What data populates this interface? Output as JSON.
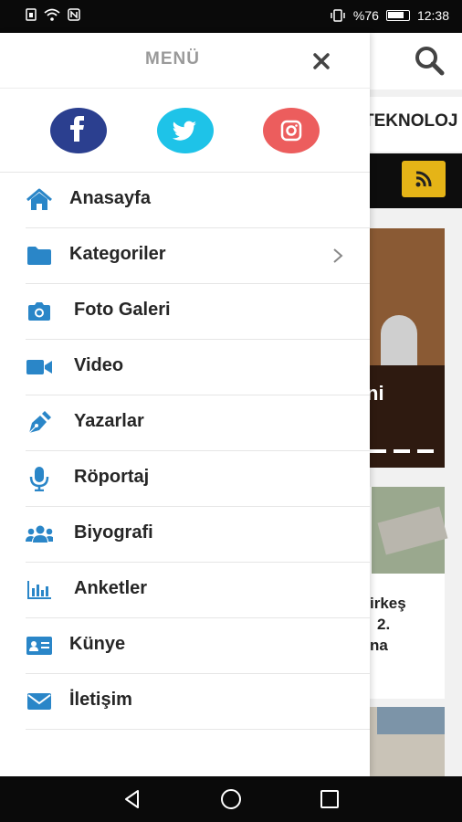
{
  "status_bar": {
    "battery": "%76",
    "time": "12:38"
  },
  "background_app": {
    "tab_label": "TEKNOLOJ",
    "hero_caption": "ni",
    "card_text": [
      "irkeş",
      "2.",
      "na"
    ]
  },
  "drawer": {
    "title": "MENÜ",
    "social": [
      {
        "name": "facebook",
        "color": "#2b3f8f"
      },
      {
        "name": "twitter",
        "color": "#1ec3e8"
      },
      {
        "name": "instagram",
        "color": "#ec5d5d"
      }
    ],
    "items": [
      {
        "label": "Anasayfa",
        "icon": "home-icon"
      },
      {
        "label": "Kategoriler",
        "icon": "folder-icon",
        "has_submenu": true
      },
      {
        "label": "Foto Galeri",
        "icon": "camera-icon"
      },
      {
        "label": "Video",
        "icon": "video-camera-icon"
      },
      {
        "label": "Yazarlar",
        "icon": "pen-icon"
      },
      {
        "label": "Röportaj",
        "icon": "microphone-icon"
      },
      {
        "label": "Biyografi",
        "icon": "users-icon"
      },
      {
        "label": "Anketler",
        "icon": "bar-chart-icon"
      },
      {
        "label": "Künye",
        "icon": "id-card-icon"
      },
      {
        "label": "İletişim",
        "icon": "envelope-icon"
      }
    ]
  },
  "colors": {
    "icon_blue": "#2a86c8",
    "rss_yellow": "#e5b417"
  }
}
